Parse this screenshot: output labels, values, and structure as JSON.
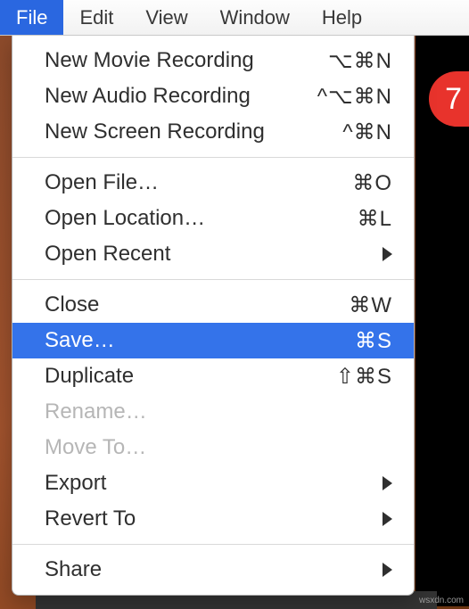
{
  "menubar": {
    "items": [
      {
        "label": "File",
        "active": true
      },
      {
        "label": "Edit",
        "active": false
      },
      {
        "label": "View",
        "active": false
      },
      {
        "label": "Window",
        "active": false
      },
      {
        "label": "Help",
        "active": false
      }
    ]
  },
  "dropdown": {
    "groups": [
      [
        {
          "label": "New Movie Recording",
          "shortcut": "⌥⌘N",
          "disabled": false,
          "submenu": false,
          "highlighted": false
        },
        {
          "label": "New Audio Recording",
          "shortcut": "^⌥⌘N",
          "disabled": false,
          "submenu": false,
          "highlighted": false
        },
        {
          "label": "New Screen Recording",
          "shortcut": "^⌘N",
          "disabled": false,
          "submenu": false,
          "highlighted": false
        }
      ],
      [
        {
          "label": "Open File…",
          "shortcut": "⌘O",
          "disabled": false,
          "submenu": false,
          "highlighted": false
        },
        {
          "label": "Open Location…",
          "shortcut": "⌘L",
          "disabled": false,
          "submenu": false,
          "highlighted": false
        },
        {
          "label": "Open Recent",
          "shortcut": "",
          "disabled": false,
          "submenu": true,
          "highlighted": false
        }
      ],
      [
        {
          "label": "Close",
          "shortcut": "⌘W",
          "disabled": false,
          "submenu": false,
          "highlighted": false
        },
        {
          "label": "Save…",
          "shortcut": "⌘S",
          "disabled": false,
          "submenu": false,
          "highlighted": true
        },
        {
          "label": "Duplicate",
          "shortcut": "⇧⌘S",
          "disabled": false,
          "submenu": false,
          "highlighted": false
        },
        {
          "label": "Rename…",
          "shortcut": "",
          "disabled": true,
          "submenu": false,
          "highlighted": false
        },
        {
          "label": "Move To…",
          "shortcut": "",
          "disabled": true,
          "submenu": false,
          "highlighted": false
        },
        {
          "label": "Export",
          "shortcut": "",
          "disabled": false,
          "submenu": true,
          "highlighted": false
        },
        {
          "label": "Revert To",
          "shortcut": "",
          "disabled": false,
          "submenu": true,
          "highlighted": false
        }
      ],
      [
        {
          "label": "Share",
          "shortcut": "",
          "disabled": false,
          "submenu": true,
          "highlighted": false
        }
      ]
    ]
  },
  "badge": {
    "text": "7"
  },
  "watermark": "wsxdn.com"
}
